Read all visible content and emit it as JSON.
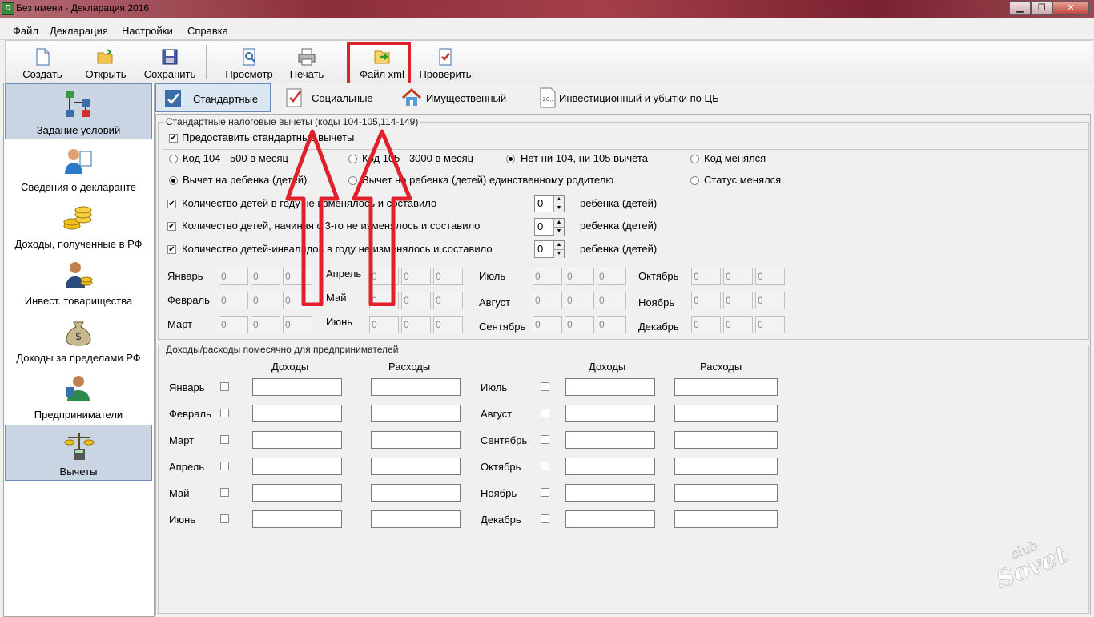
{
  "window": {
    "title": "Без имени - Декларация 2016",
    "app_icon": "D"
  },
  "menu": [
    "Файл",
    "Декларация",
    "Настройки",
    "Справка"
  ],
  "toolbar": {
    "create": "Создать",
    "open": "Открыть",
    "save": "Сохранить",
    "preview": "Просмотр",
    "print": "Печать",
    "xml": "Файл xml",
    "check": "Проверить"
  },
  "sidebar": {
    "items": [
      {
        "label": "Задание условий"
      },
      {
        "label": "Сведения о декларанте"
      },
      {
        "label": "Доходы, полученные в РФ"
      },
      {
        "label": "Инвест. товарищества"
      },
      {
        "label": "Доходы за пределами РФ"
      },
      {
        "label": "Предприниматели"
      },
      {
        "label": "Вычеты"
      }
    ]
  },
  "tabs": {
    "standard": "Стандартные",
    "social": "Социальные",
    "property": "Имущественный",
    "invest": "Инвестиционный и убытки по ЦБ",
    "invest_icon_text": "20.."
  },
  "std": {
    "group_label": "Стандартные налоговые вычеты (коды 104-105,114-149)",
    "provide": "Предоставить стандартные вычеты",
    "radio_a": [
      "Код 104 - 500 в месяц",
      "Код 105 - 3000 в месяц",
      "Нет ни 104, ни 105 вычета",
      "Код менялся"
    ],
    "radio_b": [
      "Вычет на ребенка (детей)",
      "Вычет на ребенка (детей) единственному родителю",
      "Статус менялся"
    ],
    "children": [
      {
        "label": "Количество детей в году не изменялось и составило",
        "value": "0",
        "unit": "ребенка (детей)"
      },
      {
        "label": "Количество детей, начиная с 3-го не изменялось и составило",
        "value": "0",
        "unit": "ребенка (детей)"
      },
      {
        "label": "Количество детей-инвалидов в году не изменялось и составило",
        "value": "0",
        "unit": "ребенка (детей)"
      }
    ],
    "months": [
      "Январь",
      "Февраль",
      "Март",
      "Апрель",
      "Май",
      "Июнь",
      "Июль",
      "Август",
      "Сентябрь",
      "Октябрь",
      "Ноябрь",
      "Декабрь"
    ],
    "cell_value": "0"
  },
  "biz": {
    "group_label": "Доходы/расходы помесячно для предпринимателей",
    "income": "Доходы",
    "expense": "Расходы",
    "months_left": [
      "Январь",
      "Февраль",
      "Март",
      "Апрель",
      "Май",
      "Июнь"
    ],
    "months_right": [
      "Июль",
      "Август",
      "Сентябрь",
      "Октябрь",
      "Ноябрь",
      "Декабрь"
    ]
  },
  "colors": {
    "annotation_red": "#e0202a",
    "selection": "#c9d5e3"
  }
}
